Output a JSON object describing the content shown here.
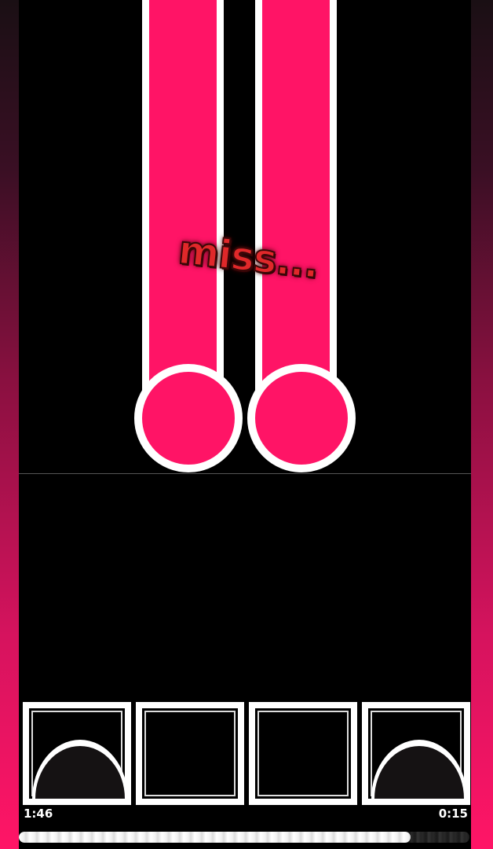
{
  "game": {
    "judgement_text": "miss...",
    "elapsed_time": "1:46",
    "remaining_time": "0:15",
    "progress": 0.87,
    "lane_count": 4,
    "lanes_pressed": [
      true,
      false,
      false,
      true
    ]
  },
  "colors": {
    "note_fill": "#ff1466",
    "note_outline": "#ffffff",
    "judgement": "#e0282a",
    "background": "#000000"
  }
}
